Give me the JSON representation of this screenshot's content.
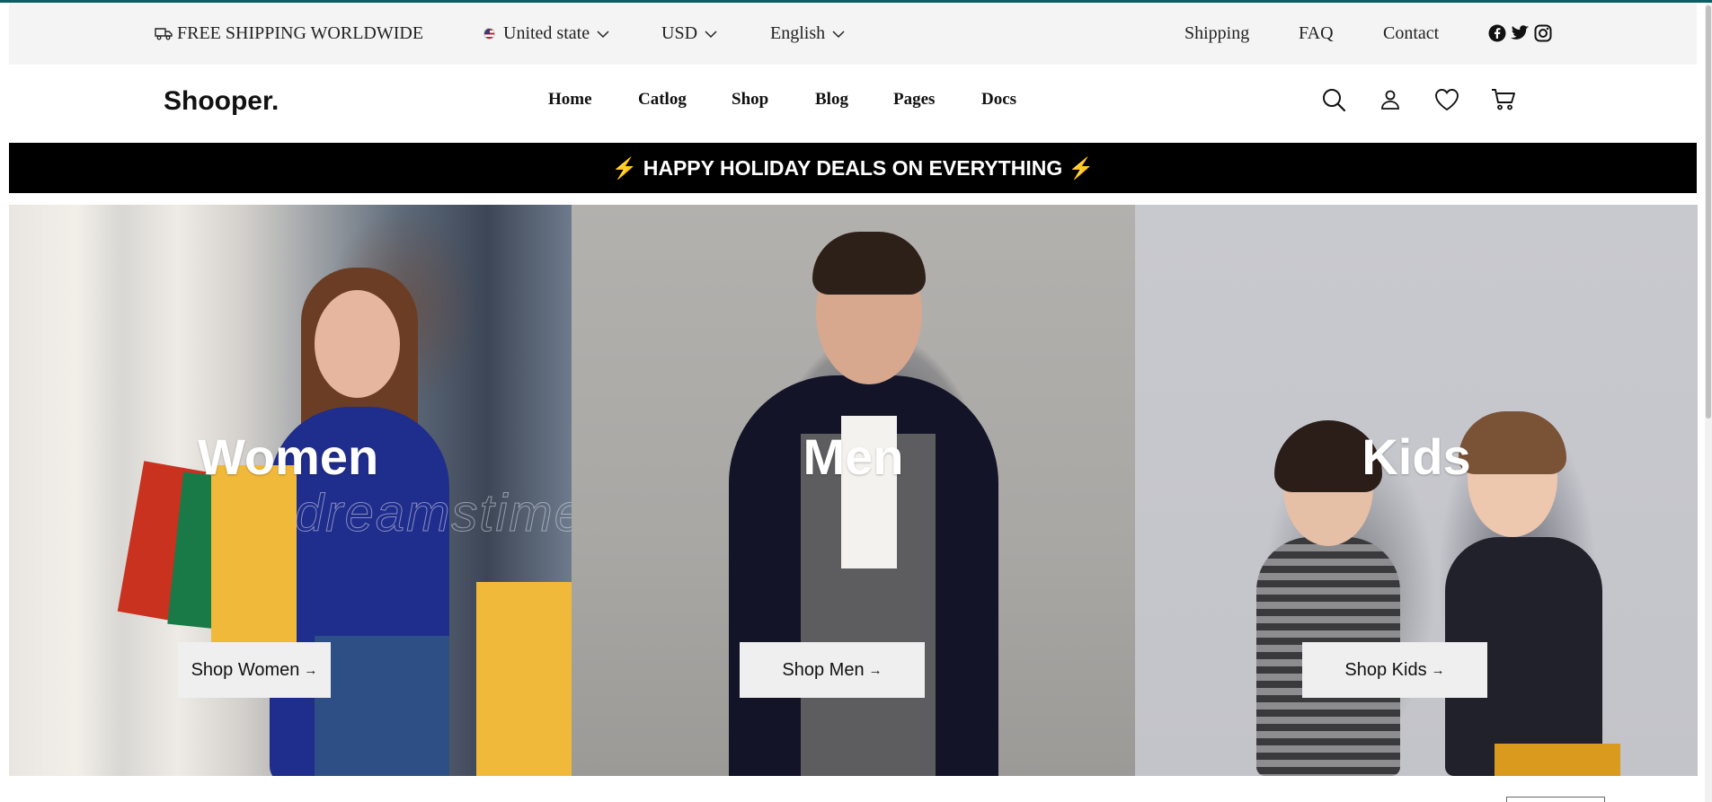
{
  "topbar": {
    "shipping_text": "FREE SHIPPING WORLDWIDE",
    "country": "United state",
    "currency": "USD",
    "language": "English",
    "links": [
      "Shipping",
      "FAQ",
      "Contact"
    ],
    "social": [
      "facebook-icon",
      "twitter-icon",
      "instagram-icon"
    ]
  },
  "header": {
    "logo": "Shooper.",
    "nav": [
      "Home",
      "Catlog",
      "Shop",
      "Blog",
      "Pages",
      "Docs"
    ],
    "icons": [
      "search-icon",
      "user-icon",
      "heart-icon",
      "cart-icon"
    ]
  },
  "announcement": "⚡ HAPPY HOLIDAY DEALS ON EVERYTHING ⚡",
  "categories": [
    {
      "title": "Women",
      "button": "Shop Women"
    },
    {
      "title": "Men",
      "button": "Shop Men"
    },
    {
      "title": "Kids",
      "button": "Shop Kids"
    }
  ],
  "watermark": "dreamstime",
  "colors": {
    "accent": "#0b5f63",
    "banner": "#000000",
    "topbar_bg": "#f4f4f4",
    "button_bg": "#efefef"
  }
}
